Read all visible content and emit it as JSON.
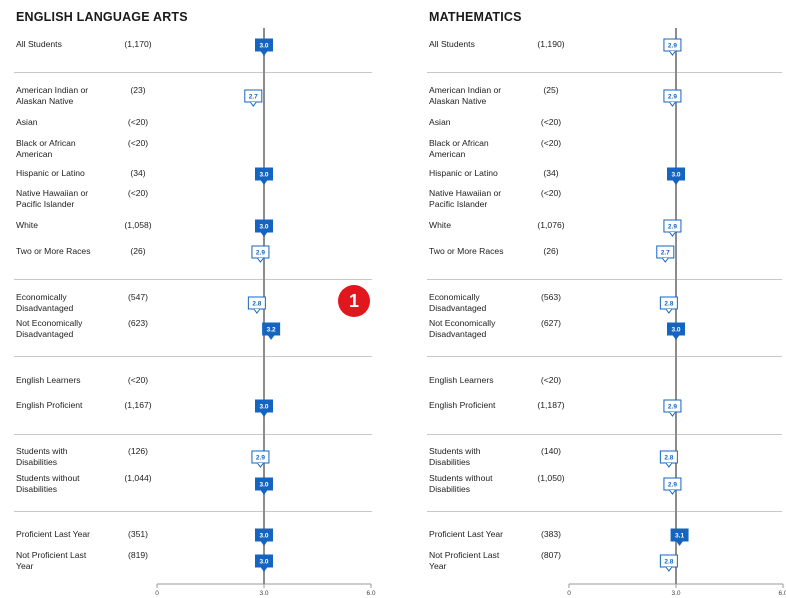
{
  "chart_data": [
    {
      "type": "bar",
      "title": "ENGLISH LANGUAGE ARTS",
      "xlim": [
        0,
        6.0
      ],
      "xticks": [
        "0",
        "3.0",
        "6.0"
      ],
      "reference_value": 3.0,
      "groups": [
        [
          {
            "label": "All Students",
            "count": "(1,170)",
            "value": 3.0,
            "display": "3.0",
            "filled": true
          }
        ],
        [
          {
            "label": "American Indian or Alaskan Native",
            "count": "(23)",
            "value": 2.7,
            "display": "2.7",
            "filled": false
          },
          {
            "label": "Asian",
            "count": "(<20)",
            "value": null,
            "display": "",
            "filled": false
          },
          {
            "label": "Black or African American",
            "count": "(<20)",
            "value": null,
            "display": "",
            "filled": false
          },
          {
            "label": "Hispanic or Latino",
            "count": "(34)",
            "value": 3.0,
            "display": "3.0",
            "filled": true
          },
          {
            "label": "Native Hawaiian or Pacific Islander",
            "count": "(<20)",
            "value": null,
            "display": "",
            "filled": false
          },
          {
            "label": "White",
            "count": "(1,058)",
            "value": 3.0,
            "display": "3.0",
            "filled": true
          },
          {
            "label": "Two or More Races",
            "count": "(26)",
            "value": 2.9,
            "display": "2.9",
            "filled": false
          }
        ],
        [
          {
            "label": "Economically Disadvantaged",
            "count": "(547)",
            "value": 2.8,
            "display": "2.8",
            "filled": false
          },
          {
            "label": "Not Economically Disadvantaged",
            "count": "(623)",
            "value": 3.2,
            "display": "3.2",
            "filled": true
          }
        ],
        [
          {
            "label": "English Learners",
            "count": "(<20)",
            "value": null,
            "display": "",
            "filled": false
          },
          {
            "label": "English Proficient",
            "count": "(1,167)",
            "value": 3.0,
            "display": "3.0",
            "filled": true
          }
        ],
        [
          {
            "label": "Students with Disabilities",
            "count": "(126)",
            "value": 2.9,
            "display": "2.9",
            "filled": false
          },
          {
            "label": "Students without Disabilities",
            "count": "(1,044)",
            "value": 3.0,
            "display": "3.0",
            "filled": true
          }
        ],
        [
          {
            "label": "Proficient Last Year",
            "count": "(351)",
            "value": 3.0,
            "display": "3.0",
            "filled": true
          },
          {
            "label": "Not Proficient Last Year",
            "count": "(819)",
            "value": 3.0,
            "display": "3.0",
            "filled": true
          }
        ]
      ]
    },
    {
      "type": "bar",
      "title": "MATHEMATICS",
      "xlim": [
        0,
        6.0
      ],
      "xticks": [
        "0",
        "3.0",
        "6.0"
      ],
      "reference_value": 3.0,
      "groups": [
        [
          {
            "label": "All Students",
            "count": "(1,190)",
            "value": 2.9,
            "display": "2.9",
            "filled": false
          }
        ],
        [
          {
            "label": "American Indian or Alaskan Native",
            "count": "(25)",
            "value": 2.9,
            "display": "2.9",
            "filled": false
          },
          {
            "label": "Asian",
            "count": "(<20)",
            "value": null,
            "display": "",
            "filled": false
          },
          {
            "label": "Black or African American",
            "count": "(<20)",
            "value": null,
            "display": "",
            "filled": false
          },
          {
            "label": "Hispanic or Latino",
            "count": "(34)",
            "value": 3.0,
            "display": "3.0",
            "filled": true
          },
          {
            "label": "Native Hawaiian or Pacific Islander",
            "count": "(<20)",
            "value": null,
            "display": "",
            "filled": false
          },
          {
            "label": "White",
            "count": "(1,076)",
            "value": 2.9,
            "display": "2.9",
            "filled": false
          },
          {
            "label": "Two or More Races",
            "count": "(26)",
            "value": 2.7,
            "display": "2.7",
            "filled": false
          }
        ],
        [
          {
            "label": "Economically Disadvantaged",
            "count": "(563)",
            "value": 2.8,
            "display": "2.8",
            "filled": false
          },
          {
            "label": "Not Economically Disadvantaged",
            "count": "(627)",
            "value": 3.0,
            "display": "3.0",
            "filled": true
          }
        ],
        [
          {
            "label": "English Learners",
            "count": "(<20)",
            "value": null,
            "display": "",
            "filled": false
          },
          {
            "label": "English Proficient",
            "count": "(1,187)",
            "value": 2.9,
            "display": "2.9",
            "filled": false
          }
        ],
        [
          {
            "label": "Students with Disabilities",
            "count": "(140)",
            "value": 2.8,
            "display": "2.8",
            "filled": false
          },
          {
            "label": "Students without Disabilities",
            "count": "(1,050)",
            "value": 2.9,
            "display": "2.9",
            "filled": false
          }
        ],
        [
          {
            "label": "Proficient Last Year",
            "count": "(383)",
            "value": 3.1,
            "display": "3.1",
            "filled": true
          },
          {
            "label": "Not Proficient Last Year",
            "count": "(807)",
            "value": 2.8,
            "display": "2.8",
            "filled": false
          }
        ]
      ]
    }
  ],
  "colors": {
    "accent": "#1565c0",
    "reference_line": "#8c8c8c",
    "divider": "#c8c8c8",
    "callout": "#e1171e"
  },
  "annotation": {
    "callout_number": "1"
  }
}
